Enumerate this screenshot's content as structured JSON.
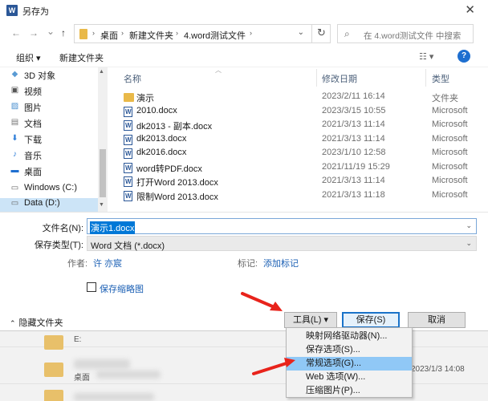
{
  "background": {
    "items": [
      {
        "label": "E:"
      },
      {
        "label": "桌面",
        "date": "2023/1/3 14:08"
      }
    ]
  },
  "window": {
    "title": "另存为",
    "app_icon": "word-icon",
    "close_glyph": "✕"
  },
  "nav": {
    "back_glyph": "←",
    "forward_glyph": "→",
    "dropdown_glyph": "⌄",
    "up_glyph": "↑",
    "breadcrumbs": [
      "桌面",
      "新建文件夹",
      "4.word测试文件"
    ],
    "crumb_sep": "›",
    "refresh_glyph": "↻",
    "search_placeholder": "在 4.word测试文件 中搜索",
    "search_glyph": "⌕"
  },
  "toolbar": {
    "organize": "组织 ▾",
    "new_folder": "新建文件夹",
    "view_glyph": "☷ ▾",
    "help_glyph": "?"
  },
  "sidebar": {
    "items": [
      {
        "label": "3D 对象",
        "icon": "cube-icon",
        "glyph": "◆"
      },
      {
        "label": "视频",
        "icon": "video-icon",
        "glyph": "▣"
      },
      {
        "label": "图片",
        "icon": "picture-icon",
        "glyph": "▨"
      },
      {
        "label": "文档",
        "icon": "document-icon",
        "glyph": "▤"
      },
      {
        "label": "下载",
        "icon": "download-icon",
        "glyph": "⬇"
      },
      {
        "label": "音乐",
        "icon": "music-icon",
        "glyph": "♪"
      },
      {
        "label": "桌面",
        "icon": "desktop-icon",
        "glyph": "▬"
      },
      {
        "label": "Windows (C:)",
        "icon": "drive-icon",
        "glyph": "▭"
      },
      {
        "label": "Data (D:)",
        "icon": "drive-icon",
        "glyph": "▭"
      }
    ]
  },
  "filelist": {
    "columns": [
      "名称",
      "修改日期",
      "类型"
    ],
    "rows": [
      {
        "name": "演示",
        "date": "2023/2/11 16:14",
        "type": "文件夹",
        "kind": "folder"
      },
      {
        "name": "2010.docx",
        "date": "2023/3/15 10:55",
        "type": "Microsoft",
        "kind": "doc"
      },
      {
        "name": "dk2013 - 副本.docx",
        "date": "2021/3/13 11:14",
        "type": "Microsoft",
        "kind": "doc"
      },
      {
        "name": "dk2013.docx",
        "date": "2021/3/13 11:14",
        "type": "Microsoft",
        "kind": "doc"
      },
      {
        "name": "dk2016.docx",
        "date": "2023/1/10 12:58",
        "type": "Microsoft",
        "kind": "doc"
      },
      {
        "name": "word转PDF.docx",
        "date": "2021/11/19 15:29",
        "type": "Microsoft",
        "kind": "doc"
      },
      {
        "name": "打开Word 2013.docx",
        "date": "2021/3/13 11:14",
        "type": "Microsoft",
        "kind": "doc"
      },
      {
        "name": "限制Word 2013.docx",
        "date": "2021/3/13 11:18",
        "type": "Microsoft",
        "kind": "doc"
      }
    ]
  },
  "form": {
    "filename_label": "文件名(N):",
    "filename_value": "演示1.docx",
    "filetype_label": "保存类型(T):",
    "filetype_value": "Word 文档 (*.docx)",
    "author_label": "作者:",
    "author_value": "许 亦宸",
    "tags_label": "标记:",
    "tags_value": "添加标记",
    "thumbnail_label": "保存缩略图",
    "dropdown_glyph": "⌄"
  },
  "footer": {
    "hide_folders": "隐藏文件夹",
    "hide_chevron": "⌃",
    "tools": "工具(L)  ▾",
    "save": "保存(S)",
    "cancel": "取消"
  },
  "tools_menu": {
    "items": [
      {
        "label": "映射网络驱动器(N)..."
      },
      {
        "label": "保存选项(S)..."
      },
      {
        "label": "常规选项(G)...",
        "highlighted": true
      },
      {
        "label": "Web 选项(W)..."
      },
      {
        "label": "压缩图片(P)..."
      }
    ]
  },
  "colors": {
    "accent": "#0078d7",
    "annotation_arrow": "#e8231b",
    "menu_highlight": "#90c8f6",
    "selection": "#cce4f7"
  }
}
